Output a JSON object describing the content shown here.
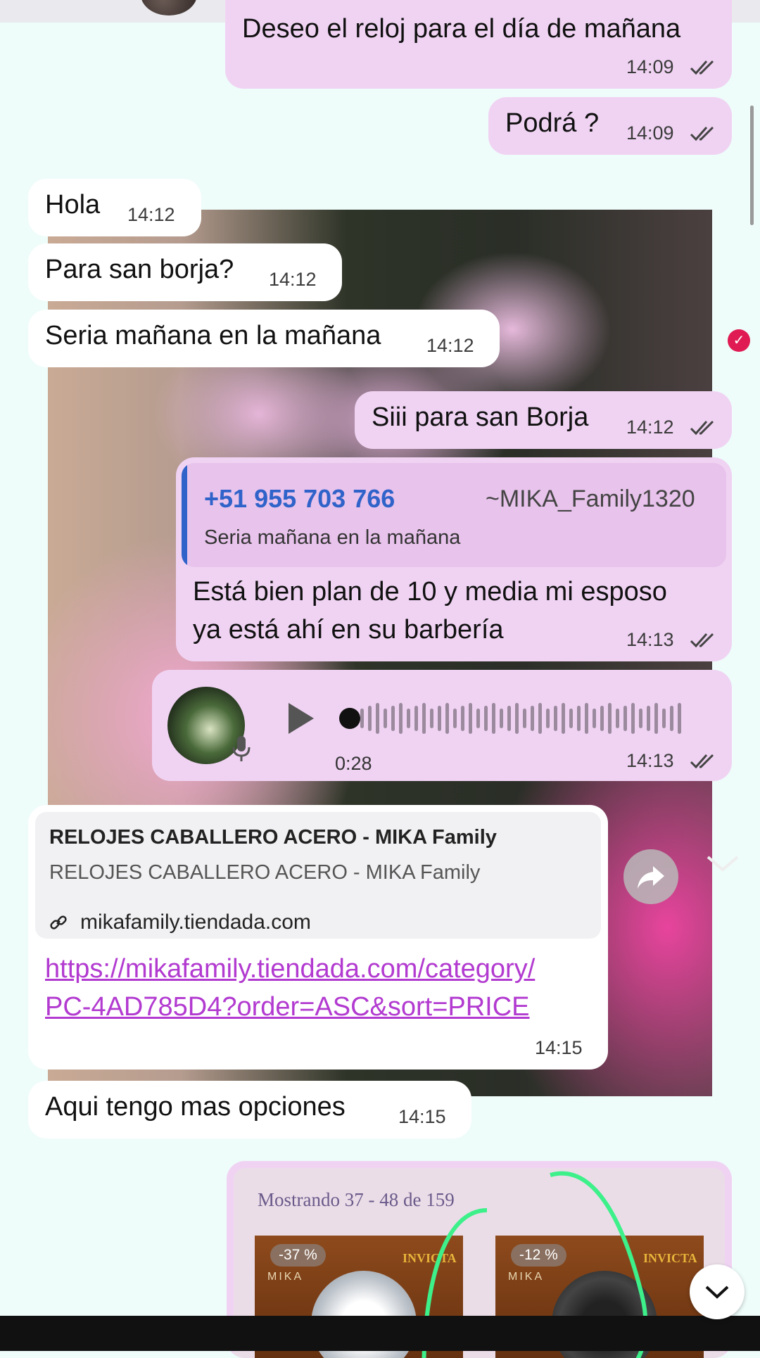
{
  "messages": {
    "m1": {
      "text": "Deseo el reloj para el día de mañana",
      "time": "14:09"
    },
    "m2": {
      "text": "Podrá ?",
      "time": "14:09"
    },
    "m3": {
      "text": "Hola",
      "time": "14:12"
    },
    "m4": {
      "text": "Para san borja?",
      "time": "14:12"
    },
    "m5": {
      "text": "Seria mañana en la mañana",
      "time": "14:12"
    },
    "m6": {
      "text": "Siii para san Borja",
      "time": "14:12"
    },
    "m7": {
      "quote_sender": "+51 955 703 766",
      "quote_name": "~MIKA_Family1320",
      "quote_text": "Seria mañana en la mañana",
      "line1": "Está bien plan de 10 y media mi esposo",
      "line2": "ya está ahí en su barbería",
      "time": "14:13"
    },
    "m8": {
      "duration": "0:28",
      "time": "14:13",
      "progress": 0
    },
    "m9": {
      "preview_title": "RELOJES CABALLERO ACERO - MIKA Family",
      "preview_subtitle": "RELOJES CABALLERO ACERO - MIKA Family",
      "preview_domain": "mikafamily.tiendada.com",
      "link_line1": "https://mikafamily.tiendada.com/category/",
      "link_line2": "PC-4AD785D4?order=ASC&sort=PRICE",
      "time": "14:15"
    },
    "m10": {
      "text": "Aqui tengo mas opciones",
      "time": "14:15"
    },
    "m11": {
      "showing": "Mostrando 37 - 48 de 159",
      "item1_discount": "-37 %",
      "item2_discount": "-12 %",
      "brand": "INVICTA",
      "store": "MIKA"
    }
  },
  "icons": {
    "read_ticks": "double-check-icon",
    "link": "link-icon",
    "play": "play-icon",
    "mic": "mic-icon",
    "forward": "forward-icon",
    "scroll_down": "chevron-down-icon"
  },
  "colors": {
    "outgoing": "#f0d3f3",
    "incoming": "#ffffff",
    "link": "#b23ad0",
    "quote_sender": "#2f63c9",
    "badge": "#e01a52"
  }
}
